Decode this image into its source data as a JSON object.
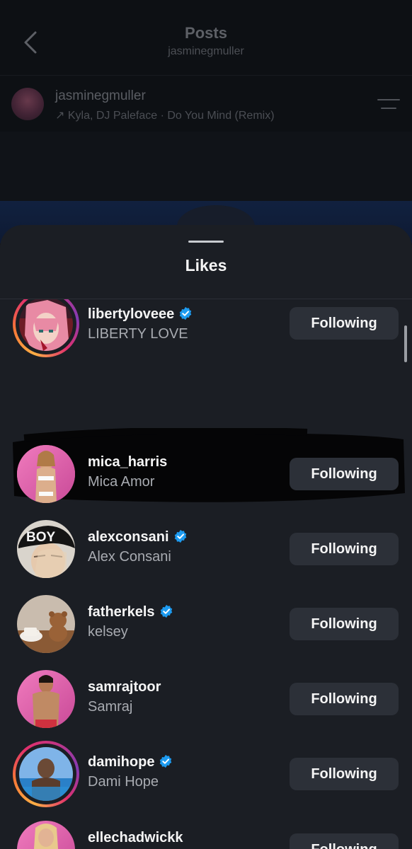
{
  "nav": {
    "title": "Posts",
    "subtitle": "jasminegmuller"
  },
  "post": {
    "username": "jasminegmuller",
    "music": "↗ Kyla, DJ Paleface · Do You Mind (Remix)"
  },
  "sheet": {
    "title": "Likes"
  },
  "likes": [
    {
      "username": "libertyloveee",
      "name": "LIBERTY LOVE",
      "verified": true,
      "button": "Following",
      "ring": true,
      "avatar": "anime-avatar"
    },
    {
      "username": "mica_harris",
      "name": "Mica Amor",
      "verified": false,
      "button": "Following",
      "ring": false,
      "avatar": "pink-avatar"
    },
    {
      "username": "alexconsani",
      "name": "Alex Consani",
      "verified": true,
      "button": "Following",
      "ring": false,
      "avatar": "boy-cap-avatar",
      "avatar_text": "BOY"
    },
    {
      "username": "fatherkels",
      "name": "kelsey",
      "verified": true,
      "button": "Following",
      "ring": false,
      "avatar": "teddy-bear-avatar"
    },
    {
      "username": "samrajtoor",
      "name": "Samraj",
      "verified": false,
      "button": "Following",
      "ring": false,
      "avatar": "pink-avatar"
    },
    {
      "username": "damihope",
      "name": "Dami Hope",
      "verified": true,
      "button": "Following",
      "ring": true,
      "avatar": "pool-avatar"
    },
    {
      "username": "ellechadwickk",
      "name": "",
      "verified": false,
      "button": "Following",
      "ring": false,
      "avatar": "pink-avatar"
    }
  ],
  "colors": {
    "accent_verified": "#1d9bf0",
    "sheet_bg": "#1b1e24",
    "button_bg": "#2c3038"
  }
}
